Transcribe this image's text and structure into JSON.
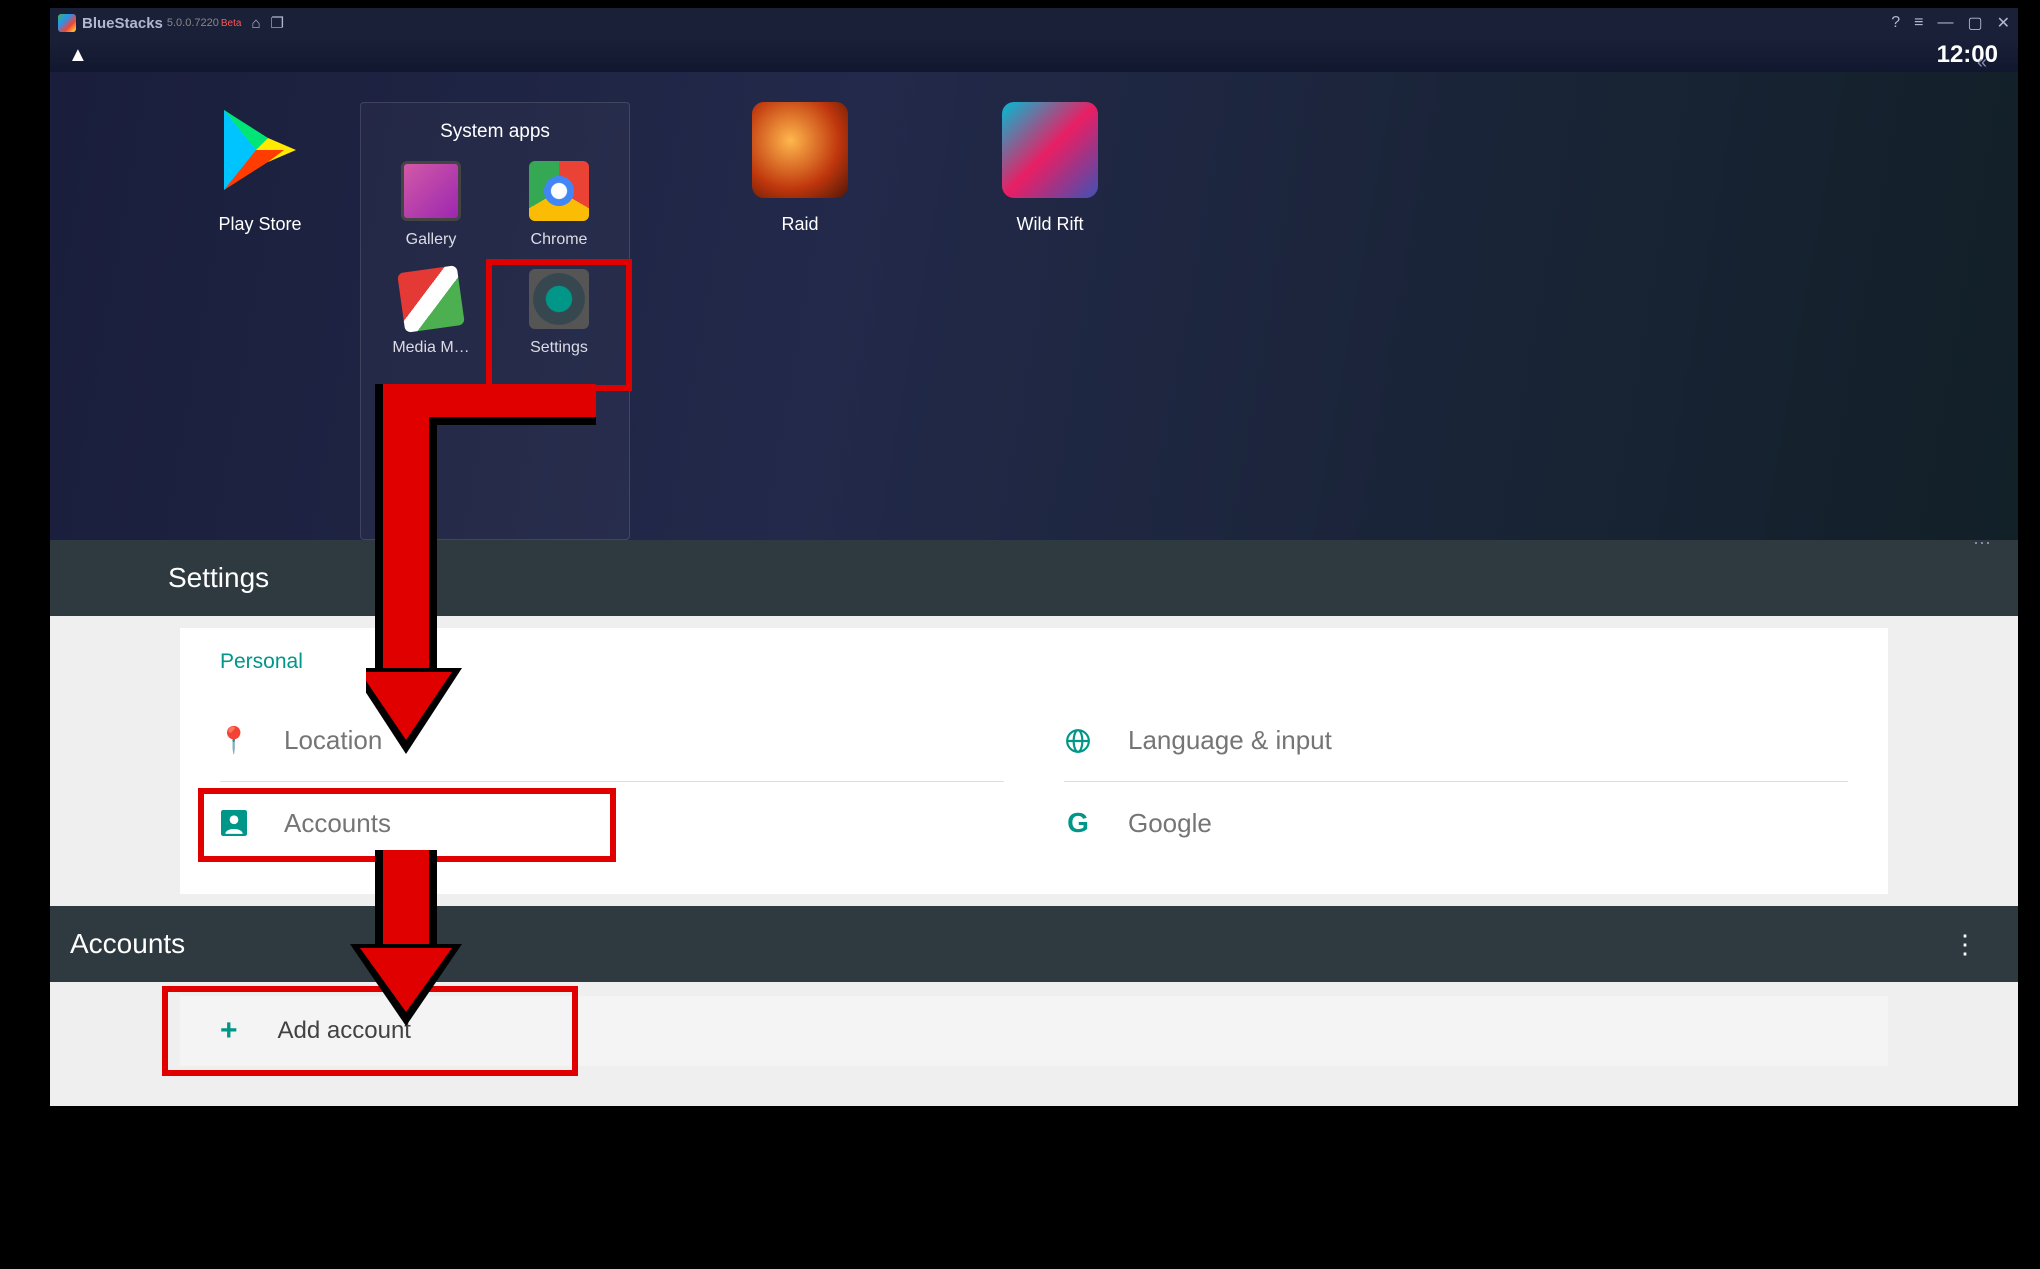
{
  "titlebar": {
    "app_name": "BlueStacks",
    "version": "5.0.0.7220",
    "beta_label": "Beta"
  },
  "topstrip": {
    "clock": "12:00"
  },
  "home": {
    "play_store_label": "Play Store",
    "raid_label": "Raid",
    "wild_rift_label": "Wild Rift",
    "system_apps_title": "System apps",
    "gallery_label": "Gallery",
    "chrome_label": "Chrome",
    "media_label": "Media M…",
    "settings_label": "Settings"
  },
  "settings": {
    "header": "Settings",
    "section_personal": "Personal",
    "item_location": "Location",
    "item_accounts": "Accounts",
    "item_language": "Language & input",
    "item_google": "Google"
  },
  "accounts": {
    "header": "Accounts",
    "add_label": "Add account"
  }
}
